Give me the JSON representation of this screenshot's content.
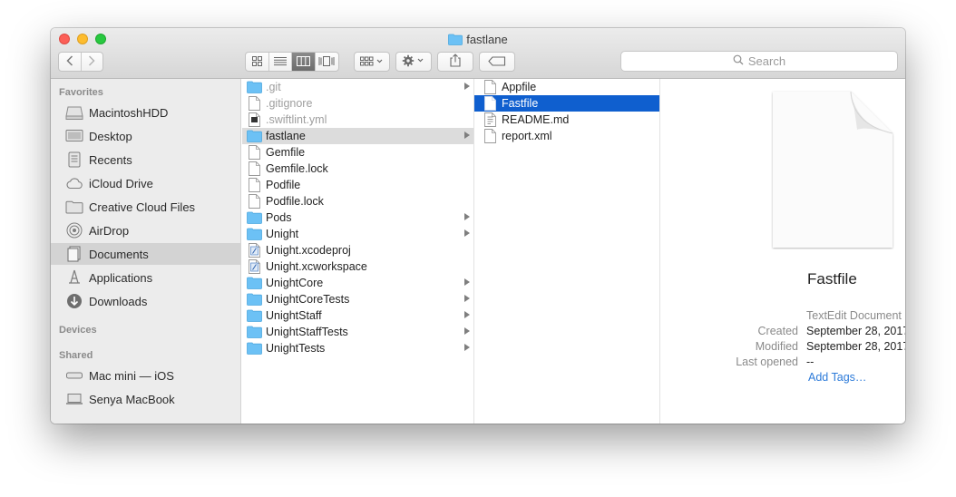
{
  "window": {
    "title": "fastlane"
  },
  "toolbar": {
    "back_icon": "chevron-left-icon",
    "forward_icon": "chevron-right-icon",
    "view_modes": [
      "icon-view-icon",
      "list-view-icon",
      "column-view-icon",
      "cover-flow-view-icon"
    ],
    "active_view": "column-view-icon",
    "arrange_icon": "arrange-icon",
    "action_icon": "gear-icon",
    "share_icon": "share-icon",
    "tags_icon": "tag-icon",
    "search_placeholder": "Search"
  },
  "sidebar": {
    "favorites_header": "Favorites",
    "favorites": [
      {
        "label": "MacintoshHDD",
        "icon": "hard-drive-icon"
      },
      {
        "label": "Desktop",
        "icon": "desktop-icon"
      },
      {
        "label": "Recents",
        "icon": "recents-icon"
      },
      {
        "label": "iCloud Drive",
        "icon": "cloud-icon"
      },
      {
        "label": "Creative Cloud Files",
        "icon": "folder-icon"
      },
      {
        "label": "AirDrop",
        "icon": "airdrop-icon"
      },
      {
        "label": "Documents",
        "icon": "documents-icon",
        "selected": true
      },
      {
        "label": "Applications",
        "icon": "applications-icon"
      },
      {
        "label": "Downloads",
        "icon": "downloads-icon"
      }
    ],
    "devices_header": "Devices",
    "shared_header": "Shared",
    "shared": [
      {
        "label": "Mac mini — iOS",
        "icon": "mac-mini-icon"
      },
      {
        "label": "Senya MacBook",
        "icon": "laptop-icon"
      }
    ]
  },
  "column1": [
    {
      "name": ".git",
      "kind": "folder",
      "dim": true,
      "arrow": true
    },
    {
      "name": ".gitignore",
      "kind": "file",
      "dim": true
    },
    {
      "name": ".swiftlint.yml",
      "kind": "exec",
      "dim": true
    },
    {
      "name": "fastlane",
      "kind": "folder",
      "arrow": true,
      "highlighted": true
    },
    {
      "name": "Gemfile",
      "kind": "file"
    },
    {
      "name": "Gemfile.lock",
      "kind": "file"
    },
    {
      "name": "Podfile",
      "kind": "file"
    },
    {
      "name": "Podfile.lock",
      "kind": "file"
    },
    {
      "name": "Pods",
      "kind": "folder",
      "arrow": true
    },
    {
      "name": "Unight",
      "kind": "folder",
      "arrow": true
    },
    {
      "name": "Unight.xcodeproj",
      "kind": "xcode"
    },
    {
      "name": "Unight.xcworkspace",
      "kind": "xcode"
    },
    {
      "name": "UnightCore",
      "kind": "folder",
      "arrow": true
    },
    {
      "name": "UnightCoreTests",
      "kind": "folder",
      "arrow": true
    },
    {
      "name": "UnightStaff",
      "kind": "folder",
      "arrow": true
    },
    {
      "name": "UnightStaffTests",
      "kind": "folder",
      "arrow": true
    },
    {
      "name": "UnightTests",
      "kind": "folder",
      "arrow": true
    }
  ],
  "column2": [
    {
      "name": "Appfile",
      "kind": "file"
    },
    {
      "name": "Fastfile",
      "kind": "file",
      "selected": true
    },
    {
      "name": "README.md",
      "kind": "text"
    },
    {
      "name": "report.xml",
      "kind": "file"
    }
  ],
  "preview": {
    "name": "Fastfile",
    "kind": "TextEdit Document",
    "created_label": "Created",
    "created_value": "September 28, 2017",
    "modified_label": "Modified",
    "modified_value": "September 28, 2017",
    "last_opened_label": "Last opened",
    "last_opened_value": "--",
    "add_tags": "Add Tags…"
  },
  "colors": {
    "selection": "#0f5fcf",
    "folder": "#6cc1f5",
    "link": "#2d7bd9"
  }
}
